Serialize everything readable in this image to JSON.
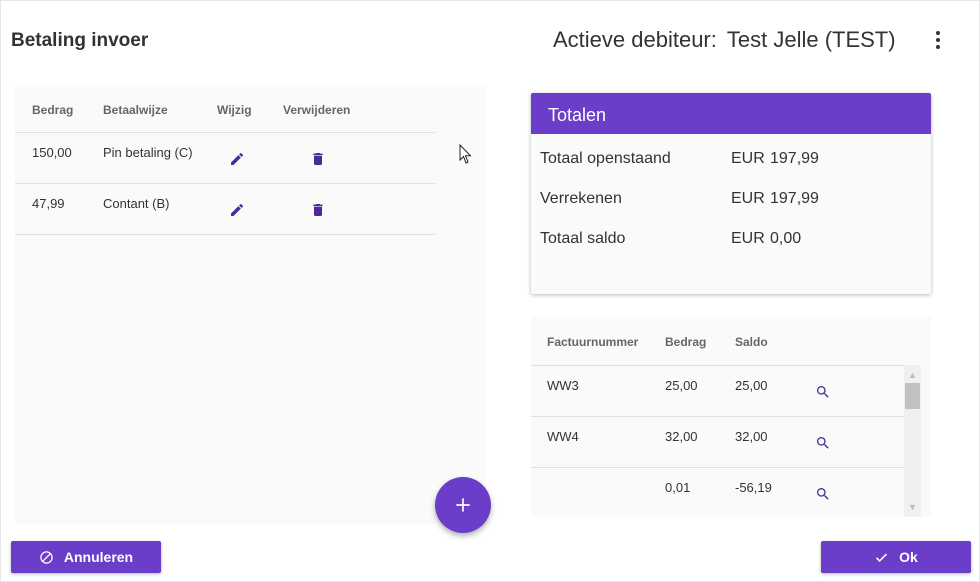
{
  "header": {
    "title": "Betaling invoer",
    "debtor_label": "Actieve debiteur:",
    "debtor_name": "Test Jelle (TEST)",
    "menu_icon": "more-vert-icon"
  },
  "payments": {
    "columns": [
      "Bedrag",
      "Betaalwijze",
      "Wijzig",
      "Verwijderen"
    ],
    "rows": [
      {
        "amount": "150,00",
        "method": "Pin betaling (C)"
      },
      {
        "amount": "47,99",
        "method": "Contant (B)"
      }
    ],
    "edit_icon": "pencil-icon",
    "delete_icon": "trash-icon",
    "add_icon": "plus-icon"
  },
  "totals": {
    "title": "Totalen",
    "rows": [
      {
        "label": "Totaal openstaand",
        "currency": "EUR",
        "value": "197,99"
      },
      {
        "label": "Verrekenen",
        "currency": "EUR",
        "value": "197,99"
      },
      {
        "label": "Totaal saldo",
        "currency": "EUR",
        "value": "0,00"
      }
    ]
  },
  "invoices": {
    "columns": [
      "Factuurnummer",
      "Bedrag",
      "Saldo"
    ],
    "rows": [
      {
        "number": "WW3",
        "amount": "25,00",
        "balance": "25,00"
      },
      {
        "number": "WW4",
        "amount": "32,00",
        "balance": "32,00"
      },
      {
        "number": "",
        "amount": "0,01",
        "balance": "-56,19"
      }
    ],
    "view_icon": "magnifier-icon"
  },
  "footer": {
    "cancel_label": "Annuleren",
    "ok_label": "Ok",
    "cancel_icon": "cancel-circle-icon",
    "ok_icon": "check-icon"
  },
  "colors": {
    "accent": "#6a3ec8",
    "icon": "#4a2a9a",
    "panel_bg": "#fafafa"
  }
}
